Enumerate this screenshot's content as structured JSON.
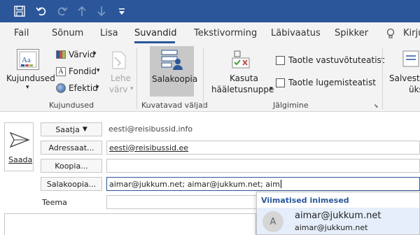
{
  "quick_access": [
    {
      "name": "save-icon",
      "glyph": "💾"
    },
    {
      "name": "undo-icon",
      "glyph": "↶"
    },
    {
      "name": "redo-icon",
      "glyph": "↷"
    },
    {
      "name": "up-icon",
      "glyph": "↑"
    },
    {
      "name": "down-icon",
      "glyph": "↓"
    },
    {
      "name": "customize-icon",
      "glyph": "▾"
    }
  ],
  "tabs": {
    "fail": "Fail",
    "sonum": "Sõnum",
    "lisa": "Lisa",
    "suvandid": "Suvandid",
    "tekstivorming": "Tekstivorming",
    "labivaatus": "Läbivaatus",
    "spikker": "Spikker",
    "search_partial": "Kirju"
  },
  "ribbon": {
    "kujundused": "Kujundused",
    "varvid": "Värvid",
    "fondid": "Fondid",
    "efektid": "Efektid",
    "lehe": "Lehe",
    "varv": "värv",
    "group_kujundused": "Kujundused",
    "salakoopia": "Salakoopia",
    "group_kuvatavad": "Kuvatavad väljad",
    "kasuta": "Kasuta",
    "haaletusnuppe": "hääletusnuppe",
    "taotle_vastuvotuteatist": "Taotle vastuvõtuteatist",
    "taotle_lugemisteatist": "Taotle lugemisteatist",
    "group_jalgimine": "Jälgimine",
    "salvesta": "Salvesta",
    "uks": "üks"
  },
  "compose": {
    "send_label": "Saada",
    "saatja_label": "Saatja",
    "saatja_value": "eesti@reisibussid.info",
    "adressaat_label": "Adressaat...",
    "adressaat_value": "eesti@reisibussid.ee",
    "koopia_label": "Koopia...",
    "koopia_value": "",
    "salakoopia_label": "Salakoopia...",
    "salakoopia_value": "aimar@jukkum.net; aimar@jukkum.net; aim",
    "teema_label": "Teema",
    "teema_value": ""
  },
  "autocomplete": {
    "header": "Viimatised inimesed",
    "avatar_initial": "A",
    "name": "aimar@jukkum.net",
    "email": "aimar@jukkum.net"
  },
  "colors": {
    "accent": "#2b579a",
    "ribbon_bg": "#f3f3f3",
    "selected_button": "#c8c8c8",
    "dropdown_highlight": "#e5eefa"
  }
}
